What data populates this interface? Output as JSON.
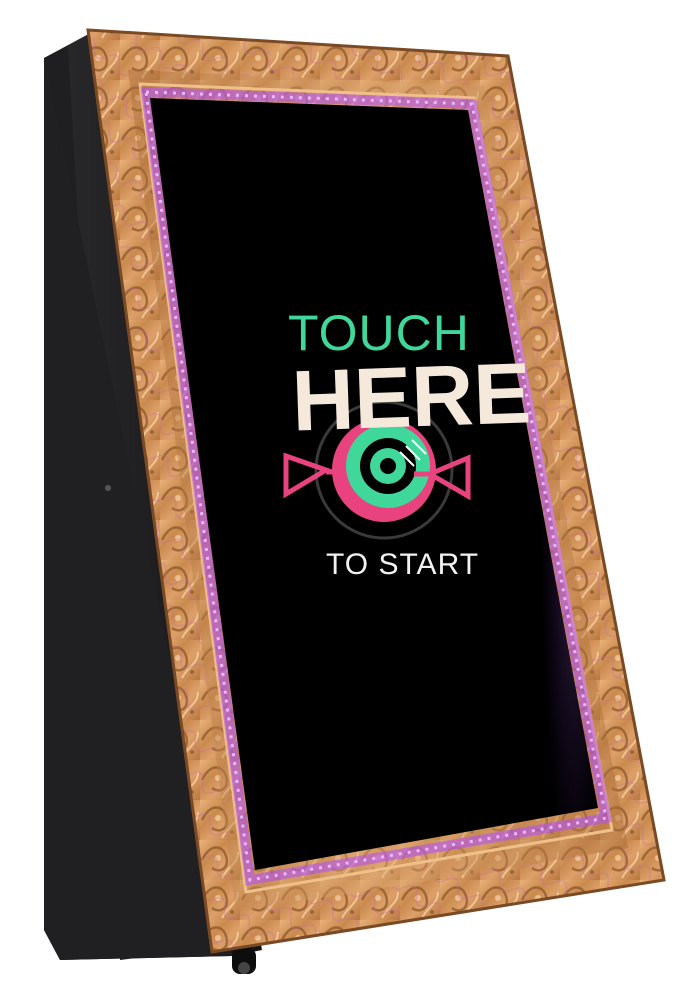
{
  "screen": {
    "line1": "TOUCH",
    "line2": "HERE",
    "line3": "TO START"
  },
  "colors": {
    "touch_green": "#3fd89a",
    "here_cream": "#f5e9dc",
    "target_pink": "#e8437f",
    "target_green": "#3fd89a",
    "led_purple": "#a35cf0",
    "frame_gold": "#d59a58",
    "cabinet_black": "#1c1c1e",
    "screen_black": "#000000"
  },
  "icons": [
    "target-icon",
    "arrow-left-icon",
    "arrow-right-icon"
  ]
}
